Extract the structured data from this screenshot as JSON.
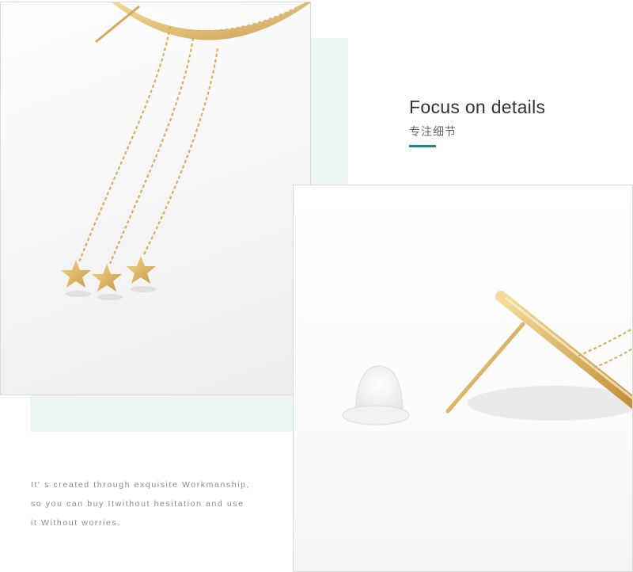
{
  "heading": {
    "title": "Focus on details",
    "subtitle": "专注细节"
  },
  "caption": {
    "lines": [
      "It' s created through exquisite Workmanship,",
      "so you can buy Itwithout hesitation and use",
      "it Without worries."
    ]
  },
  "colors": {
    "accent": "#1f8090",
    "panel": "#eef5f5",
    "gold": "#d9ae5c"
  }
}
